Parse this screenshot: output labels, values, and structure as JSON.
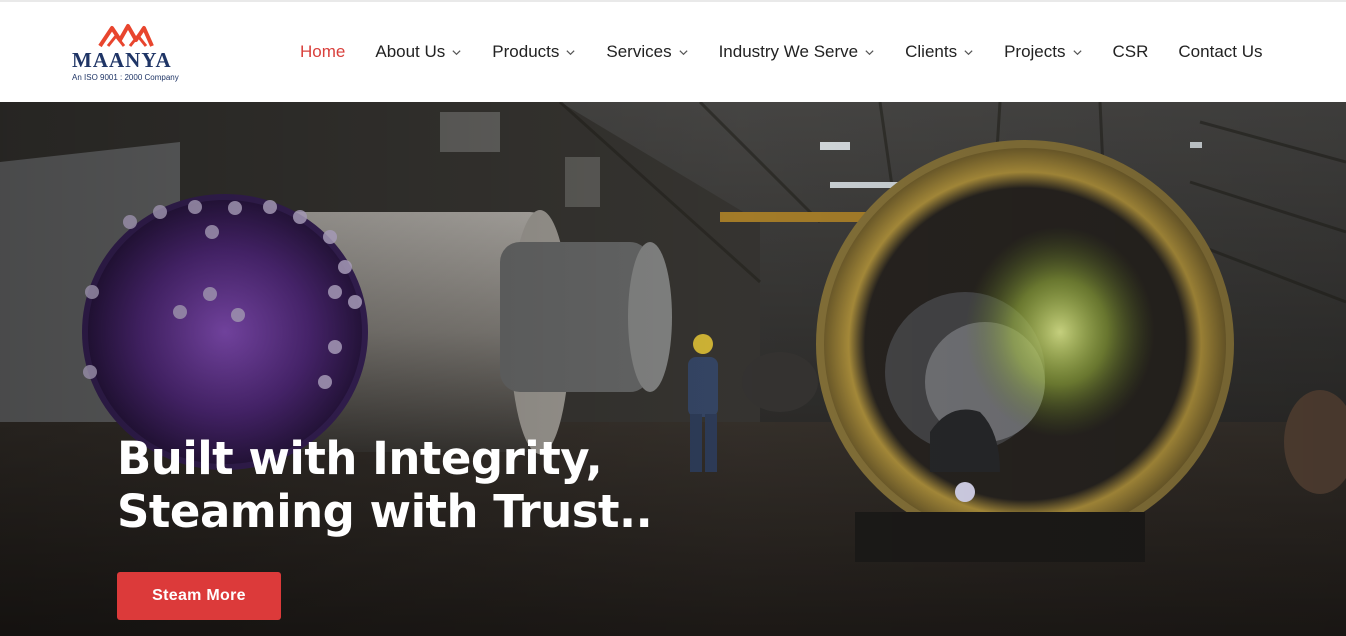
{
  "brand": {
    "name": "MAANYA",
    "tagline": "An ISO 9001 : 2000 Company",
    "colors": {
      "primary": "#1f3566",
      "accent": "#e8452e"
    }
  },
  "nav": {
    "items": [
      {
        "label": "Home",
        "active": true,
        "has_dropdown": false
      },
      {
        "label": "About Us",
        "active": false,
        "has_dropdown": true
      },
      {
        "label": "Products",
        "active": false,
        "has_dropdown": true
      },
      {
        "label": "Services",
        "active": false,
        "has_dropdown": true
      },
      {
        "label": "Industry We Serve",
        "active": false,
        "has_dropdown": true
      },
      {
        "label": "Clients",
        "active": false,
        "has_dropdown": true
      },
      {
        "label": "Projects",
        "active": false,
        "has_dropdown": true
      },
      {
        "label": "CSR",
        "active": false,
        "has_dropdown": false
      },
      {
        "label": "Contact Us",
        "active": false,
        "has_dropdown": false
      }
    ],
    "active_color": "#d9403c",
    "text_color": "#222222",
    "dropdown_icon": "chevron-down-icon"
  },
  "hero": {
    "title_line1": "Built with Integrity,",
    "title_line2": "Steaming with Trust..",
    "cta_label": "Steam More",
    "cta_color": "#dc3a3a"
  }
}
